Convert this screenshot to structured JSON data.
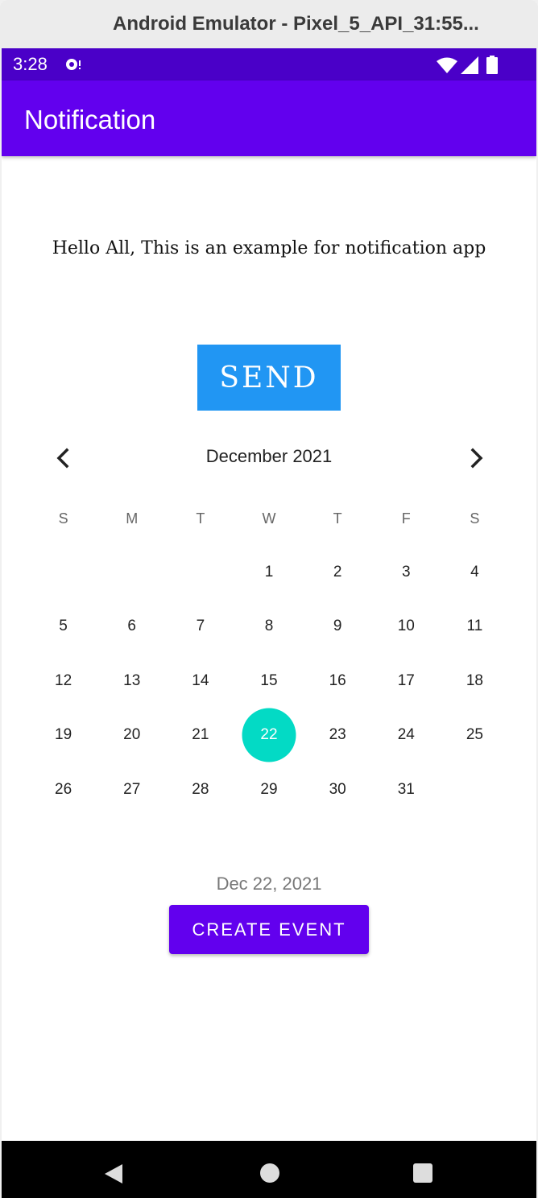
{
  "window": {
    "title": "Android Emulator - Pixel_5_API_31:55..."
  },
  "status_bar": {
    "time": "3:28"
  },
  "app_bar": {
    "title": "Notification"
  },
  "main": {
    "message": "Hello All, This is an example for notification app",
    "send_label": "SEND"
  },
  "calendar": {
    "month_label": "December 2021",
    "weekdays": [
      "S",
      "M",
      "T",
      "W",
      "T",
      "F",
      "S"
    ],
    "leading_blanks": 3,
    "days_in_month": 31,
    "selected_day": 22
  },
  "selected_date": "Dec 22, 2021",
  "create_event_label": "CREATE EVENT",
  "colors": {
    "status_bar": "#4a00c8",
    "app_bar": "#6200ee",
    "send_button": "#2196f3",
    "selected_day": "#03dac5",
    "create_button": "#6200ee"
  },
  "icons": {
    "status": [
      "notification-icon",
      "wifi-icon",
      "signal-icon",
      "battery-icon"
    ],
    "calendar_nav": [
      "chevron-left-icon",
      "chevron-right-icon"
    ],
    "system_nav": [
      "back-icon",
      "home-icon",
      "recents-icon"
    ]
  }
}
